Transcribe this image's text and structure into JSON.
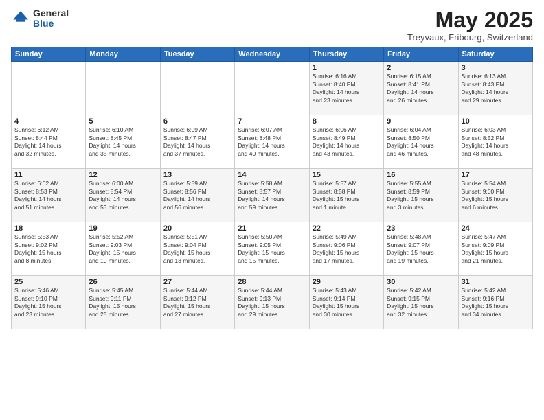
{
  "logo": {
    "general": "General",
    "blue": "Blue"
  },
  "title": "May 2025",
  "subtitle": "Treyvaux, Fribourg, Switzerland",
  "headers": [
    "Sunday",
    "Monday",
    "Tuesday",
    "Wednesday",
    "Thursday",
    "Friday",
    "Saturday"
  ],
  "weeks": [
    [
      {
        "day": "",
        "info": ""
      },
      {
        "day": "",
        "info": ""
      },
      {
        "day": "",
        "info": ""
      },
      {
        "day": "",
        "info": ""
      },
      {
        "day": "1",
        "info": "Sunrise: 6:16 AM\nSunset: 8:40 PM\nDaylight: 14 hours\nand 23 minutes."
      },
      {
        "day": "2",
        "info": "Sunrise: 6:15 AM\nSunset: 8:41 PM\nDaylight: 14 hours\nand 26 minutes."
      },
      {
        "day": "3",
        "info": "Sunrise: 6:13 AM\nSunset: 8:43 PM\nDaylight: 14 hours\nand 29 minutes."
      }
    ],
    [
      {
        "day": "4",
        "info": "Sunrise: 6:12 AM\nSunset: 8:44 PM\nDaylight: 14 hours\nand 32 minutes."
      },
      {
        "day": "5",
        "info": "Sunrise: 6:10 AM\nSunset: 8:45 PM\nDaylight: 14 hours\nand 35 minutes."
      },
      {
        "day": "6",
        "info": "Sunrise: 6:09 AM\nSunset: 8:47 PM\nDaylight: 14 hours\nand 37 minutes."
      },
      {
        "day": "7",
        "info": "Sunrise: 6:07 AM\nSunset: 8:48 PM\nDaylight: 14 hours\nand 40 minutes."
      },
      {
        "day": "8",
        "info": "Sunrise: 6:06 AM\nSunset: 8:49 PM\nDaylight: 14 hours\nand 43 minutes."
      },
      {
        "day": "9",
        "info": "Sunrise: 6:04 AM\nSunset: 8:50 PM\nDaylight: 14 hours\nand 46 minutes."
      },
      {
        "day": "10",
        "info": "Sunrise: 6:03 AM\nSunset: 8:52 PM\nDaylight: 14 hours\nand 48 minutes."
      }
    ],
    [
      {
        "day": "11",
        "info": "Sunrise: 6:02 AM\nSunset: 8:53 PM\nDaylight: 14 hours\nand 51 minutes."
      },
      {
        "day": "12",
        "info": "Sunrise: 6:00 AM\nSunset: 8:54 PM\nDaylight: 14 hours\nand 53 minutes."
      },
      {
        "day": "13",
        "info": "Sunrise: 5:59 AM\nSunset: 8:56 PM\nDaylight: 14 hours\nand 56 minutes."
      },
      {
        "day": "14",
        "info": "Sunrise: 5:58 AM\nSunset: 8:57 PM\nDaylight: 14 hours\nand 59 minutes."
      },
      {
        "day": "15",
        "info": "Sunrise: 5:57 AM\nSunset: 8:58 PM\nDaylight: 15 hours\nand 1 minute."
      },
      {
        "day": "16",
        "info": "Sunrise: 5:55 AM\nSunset: 8:59 PM\nDaylight: 15 hours\nand 3 minutes."
      },
      {
        "day": "17",
        "info": "Sunrise: 5:54 AM\nSunset: 9:00 PM\nDaylight: 15 hours\nand 6 minutes."
      }
    ],
    [
      {
        "day": "18",
        "info": "Sunrise: 5:53 AM\nSunset: 9:02 PM\nDaylight: 15 hours\nand 8 minutes."
      },
      {
        "day": "19",
        "info": "Sunrise: 5:52 AM\nSunset: 9:03 PM\nDaylight: 15 hours\nand 10 minutes."
      },
      {
        "day": "20",
        "info": "Sunrise: 5:51 AM\nSunset: 9:04 PM\nDaylight: 15 hours\nand 13 minutes."
      },
      {
        "day": "21",
        "info": "Sunrise: 5:50 AM\nSunset: 9:05 PM\nDaylight: 15 hours\nand 15 minutes."
      },
      {
        "day": "22",
        "info": "Sunrise: 5:49 AM\nSunset: 9:06 PM\nDaylight: 15 hours\nand 17 minutes."
      },
      {
        "day": "23",
        "info": "Sunrise: 5:48 AM\nSunset: 9:07 PM\nDaylight: 15 hours\nand 19 minutes."
      },
      {
        "day": "24",
        "info": "Sunrise: 5:47 AM\nSunset: 9:09 PM\nDaylight: 15 hours\nand 21 minutes."
      }
    ],
    [
      {
        "day": "25",
        "info": "Sunrise: 5:46 AM\nSunset: 9:10 PM\nDaylight: 15 hours\nand 23 minutes."
      },
      {
        "day": "26",
        "info": "Sunrise: 5:45 AM\nSunset: 9:11 PM\nDaylight: 15 hours\nand 25 minutes."
      },
      {
        "day": "27",
        "info": "Sunrise: 5:44 AM\nSunset: 9:12 PM\nDaylight: 15 hours\nand 27 minutes."
      },
      {
        "day": "28",
        "info": "Sunrise: 5:44 AM\nSunset: 9:13 PM\nDaylight: 15 hours\nand 29 minutes."
      },
      {
        "day": "29",
        "info": "Sunrise: 5:43 AM\nSunset: 9:14 PM\nDaylight: 15 hours\nand 30 minutes."
      },
      {
        "day": "30",
        "info": "Sunrise: 5:42 AM\nSunset: 9:15 PM\nDaylight: 15 hours\nand 32 minutes."
      },
      {
        "day": "31",
        "info": "Sunrise: 5:42 AM\nSunset: 9:16 PM\nDaylight: 15 hours\nand 34 minutes."
      }
    ]
  ]
}
